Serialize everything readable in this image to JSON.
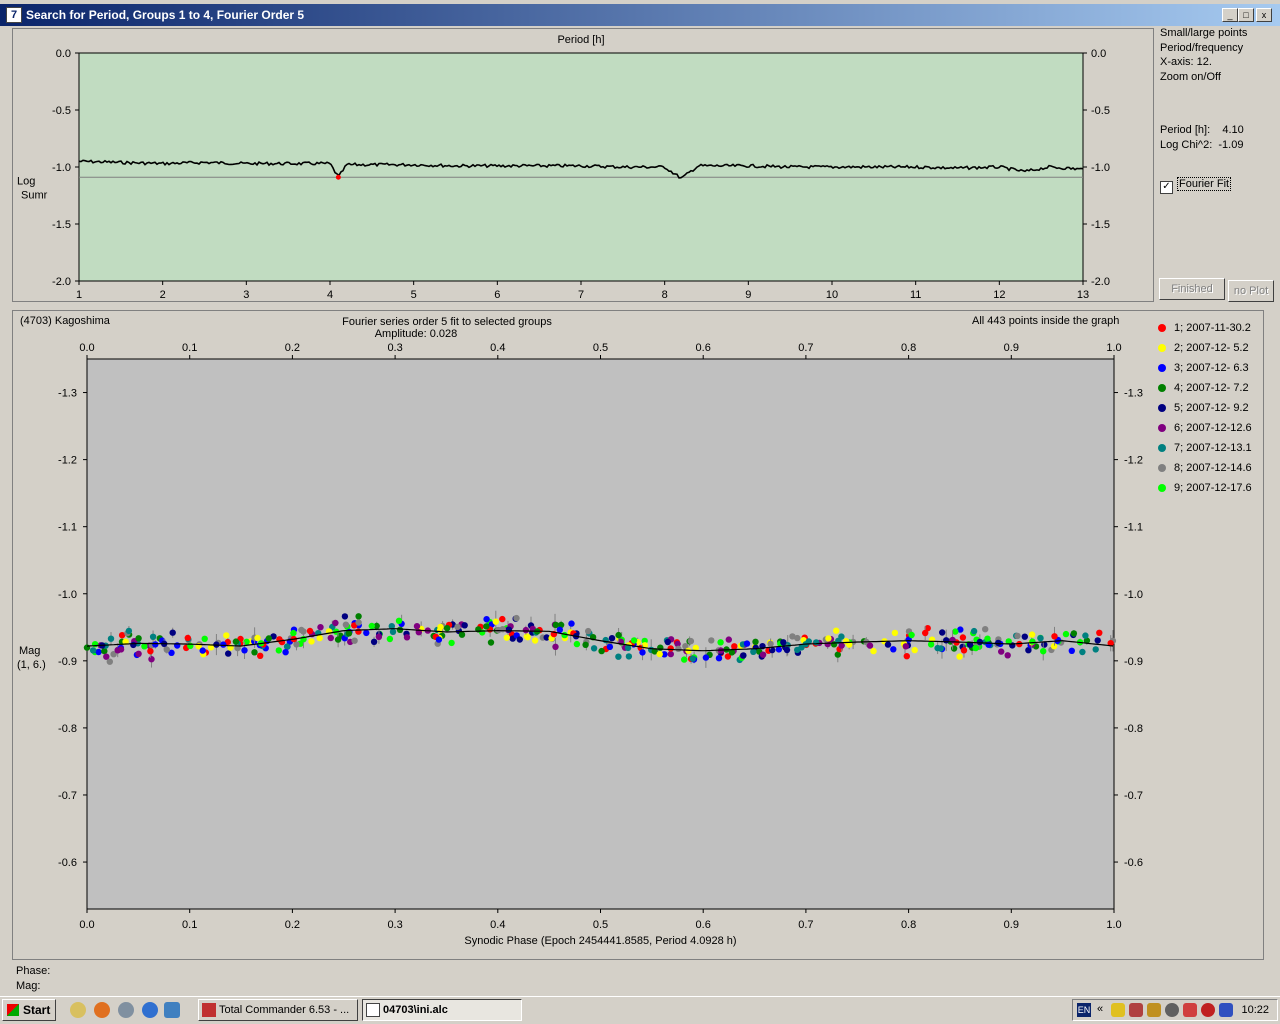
{
  "window": {
    "title": "Search for Period, Groups 1 to 4, Fourier Order 5",
    "icon_label": "7",
    "controls": [
      "_",
      "□",
      "x"
    ]
  },
  "upper_panel": {
    "options": [
      "Small/large points",
      "Period/frequency",
      "X-axis: 12.",
      "Zoom on/Off"
    ],
    "period_label": "Period [h]:",
    "period_value": "4.10",
    "chi_label": "Log Chi^2:",
    "chi_value": "-1.09",
    "fourier_fit_label": "Fourier Fit",
    "fourier_fit_checked": true,
    "finished_label": "Finished",
    "noplot_label": "no Plot"
  },
  "lower_panel": {
    "object": "(4703) Kagoshima",
    "points_info": "All 443 points inside the graph"
  },
  "status": {
    "phase_label": "Phase:",
    "mag_label": "Mag:"
  },
  "taskbar": {
    "start_label": "Start",
    "tasks": [
      {
        "label": "Total Commander 6.53 - ...",
        "active": false
      },
      {
        "label": "04703\\ini.alc",
        "active": true
      }
    ],
    "tray_lang": "EN",
    "tray_chevron": "«",
    "clock": "10:22"
  },
  "colors": {
    "upper_plot_bg": "#c1dcc1",
    "lower_plot_bg": "#c0c0c0",
    "title_gradient_start": "#0a246a",
    "title_gradient_end": "#a6caf0"
  },
  "chart_data": [
    {
      "type": "line",
      "title": "Period [h]",
      "xlabel": "",
      "ylabel": "Log Sumr",
      "xlim": [
        1,
        13
      ],
      "ylim": [
        0.0,
        -2.0
      ],
      "xticks": [
        1,
        2,
        3,
        4,
        5,
        6,
        7,
        8,
        9,
        10,
        11,
        12,
        13
      ],
      "yticks": [
        "0.0",
        "-0.5",
        "-1.0",
        "-1.5",
        "-2.0"
      ],
      "x": [
        1.0,
        1.5,
        2.0,
        2.5,
        3.0,
        3.5,
        4.0,
        4.1,
        4.2,
        4.5,
        5.0,
        5.5,
        6.0,
        6.5,
        7.0,
        7.5,
        8.0,
        8.2,
        8.4,
        9.0,
        9.5,
        10.0,
        10.5,
        11.0,
        11.5,
        12.0,
        12.3,
        12.6,
        13.0
      ],
      "y": [
        -0.95,
        -0.96,
        -0.97,
        -0.96,
        -0.97,
        -0.97,
        -0.97,
        -1.09,
        -0.98,
        -0.98,
        -0.98,
        -0.99,
        -0.99,
        -0.99,
        -0.99,
        -1.0,
        -1.0,
        -1.1,
        -0.99,
        -0.99,
        -1.0,
        -1.0,
        -1.0,
        -1.0,
        -1.01,
        -1.0,
        -1.04,
        -1.0,
        -1.02
      ],
      "reference_line": -1.09,
      "marker": {
        "x": 4.1,
        "y": -1.09,
        "color": "#ff0000"
      },
      "grid": false
    },
    {
      "type": "scatter",
      "title": "Fourier series order 5 fit to selected groups",
      "subtitle": "Amplitude: 0.028",
      "xlabel": "Synodic Phase (Epoch 2454441.8585, Period 4.0928 h)",
      "ylabel": "Mag (1, 6.)",
      "xlim": [
        0.0,
        1.0
      ],
      "ylim": [
        -1.35,
        -0.53
      ],
      "xticks": [
        "0.0",
        "0.1",
        "0.2",
        "0.3",
        "0.4",
        "0.5",
        "0.6",
        "0.7",
        "0.8",
        "0.9",
        "1.0"
      ],
      "yticks": [
        "-1.3",
        "-1.2",
        "-1.1",
        "-1.0",
        "-0.9",
        "-0.8",
        "-0.7",
        "-0.6"
      ],
      "fit_curve": {
        "x": [
          0.0,
          0.05,
          0.1,
          0.15,
          0.2,
          0.25,
          0.3,
          0.35,
          0.4,
          0.45,
          0.5,
          0.55,
          0.6,
          0.65,
          0.7,
          0.75,
          0.8,
          0.85,
          0.9,
          0.95,
          1.0
        ],
        "y": [
          -0.922,
          -0.926,
          -0.925,
          -0.922,
          -0.932,
          -0.945,
          -0.948,
          -0.943,
          -0.945,
          -0.944,
          -0.93,
          -0.918,
          -0.915,
          -0.918,
          -0.925,
          -0.928,
          -0.93,
          -0.928,
          -0.925,
          -0.93,
          -0.922
        ]
      },
      "series": [
        {
          "name": "1; 2007-11-30.2",
          "color": "#ff0000"
        },
        {
          "name": "2; 2007-12- 5.2",
          "color": "#ffff00"
        },
        {
          "name": "3; 2007-12- 6.3",
          "color": "#0000ff"
        },
        {
          "name": "4; 2007-12- 7.2",
          "color": "#008000"
        },
        {
          "name": "5; 2007-12- 9.2",
          "color": "#000080"
        },
        {
          "name": "6; 2007-12-12.6",
          "color": "#800080"
        },
        {
          "name": "7; 2007-12-13.1",
          "color": "#008080"
        },
        {
          "name": "8; 2007-12-14.6",
          "color": "#808080"
        },
        {
          "name": "9; 2007-12-17.6",
          "color": "#00ff00"
        }
      ],
      "point_count": 443,
      "grid": false
    }
  ]
}
